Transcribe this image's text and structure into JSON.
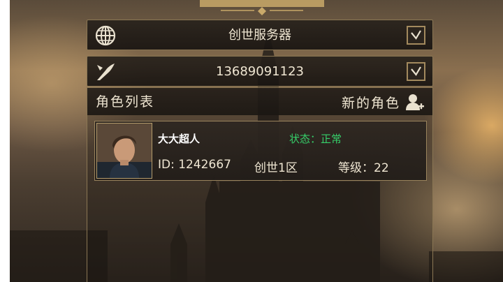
{
  "server_row": {
    "label": "创世服务器",
    "icon": "globe-icon"
  },
  "account_row": {
    "label": "13689091123",
    "icon": "quill-icon"
  },
  "role_list": {
    "title": "角色列表",
    "new_role_label": "新的角色",
    "characters": [
      {
        "name": "大大超人",
        "status": "状态：正常",
        "id": "ID: 1242667",
        "server": "创世1区",
        "level": "等级：22"
      }
    ]
  },
  "colors": {
    "panel_border": "#8b7754",
    "status_green": "#36d06a",
    "text": "#efe6d2"
  }
}
